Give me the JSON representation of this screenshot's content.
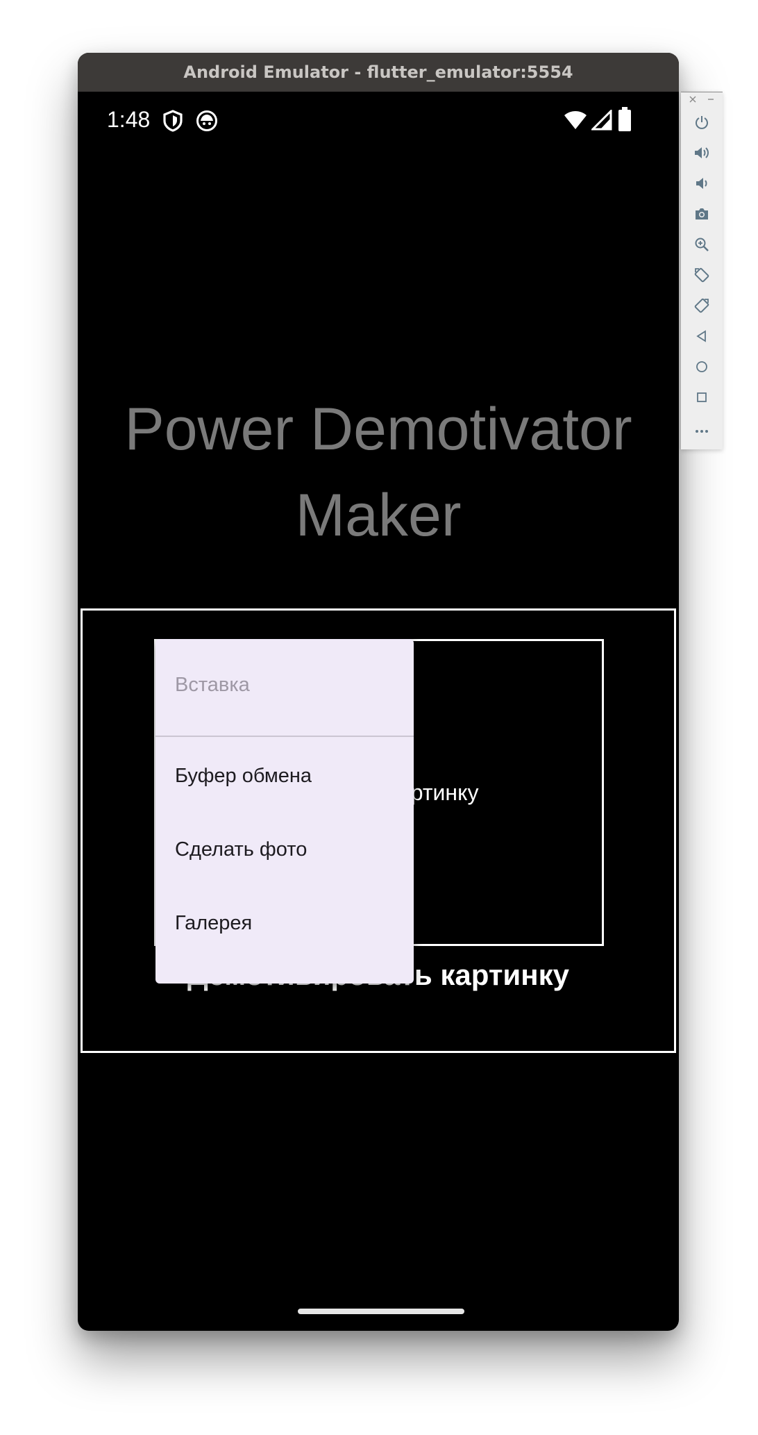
{
  "window": {
    "title": "Android Emulator - flutter_emulator:5554"
  },
  "status_bar": {
    "time": "1:48",
    "left_icons": [
      "shield-icon",
      "android-icon"
    ],
    "right_icons": [
      "wifi-icon",
      "cellular-signal-icon",
      "battery-icon"
    ]
  },
  "app": {
    "title_line1": "Power Demotivator",
    "title_line2": "Maker",
    "image_placeholder": "Выберите картинку",
    "caption": "Демотивировать картинку"
  },
  "menu": {
    "header": "Вставка",
    "items": [
      {
        "label": "Буфер обмена"
      },
      {
        "label": "Сделать фото"
      },
      {
        "label": "Галерея"
      }
    ]
  },
  "emulator_toolbar": {
    "window_controls": [
      "close-icon",
      "minimize-icon"
    ],
    "buttons": [
      "power-icon",
      "volume-up-icon",
      "volume-down-icon",
      "camera-icon",
      "zoom-icon",
      "rotate-left-icon",
      "rotate-right-icon",
      "back-icon",
      "home-icon",
      "overview-icon",
      "more-icon"
    ]
  },
  "colors": {
    "titlebar": "#3d3a38",
    "screen": "#000000",
    "menu_surface": "#f0eaf8",
    "title_text": "#7a7a7a",
    "toolbar_icon": "#5f7787"
  }
}
